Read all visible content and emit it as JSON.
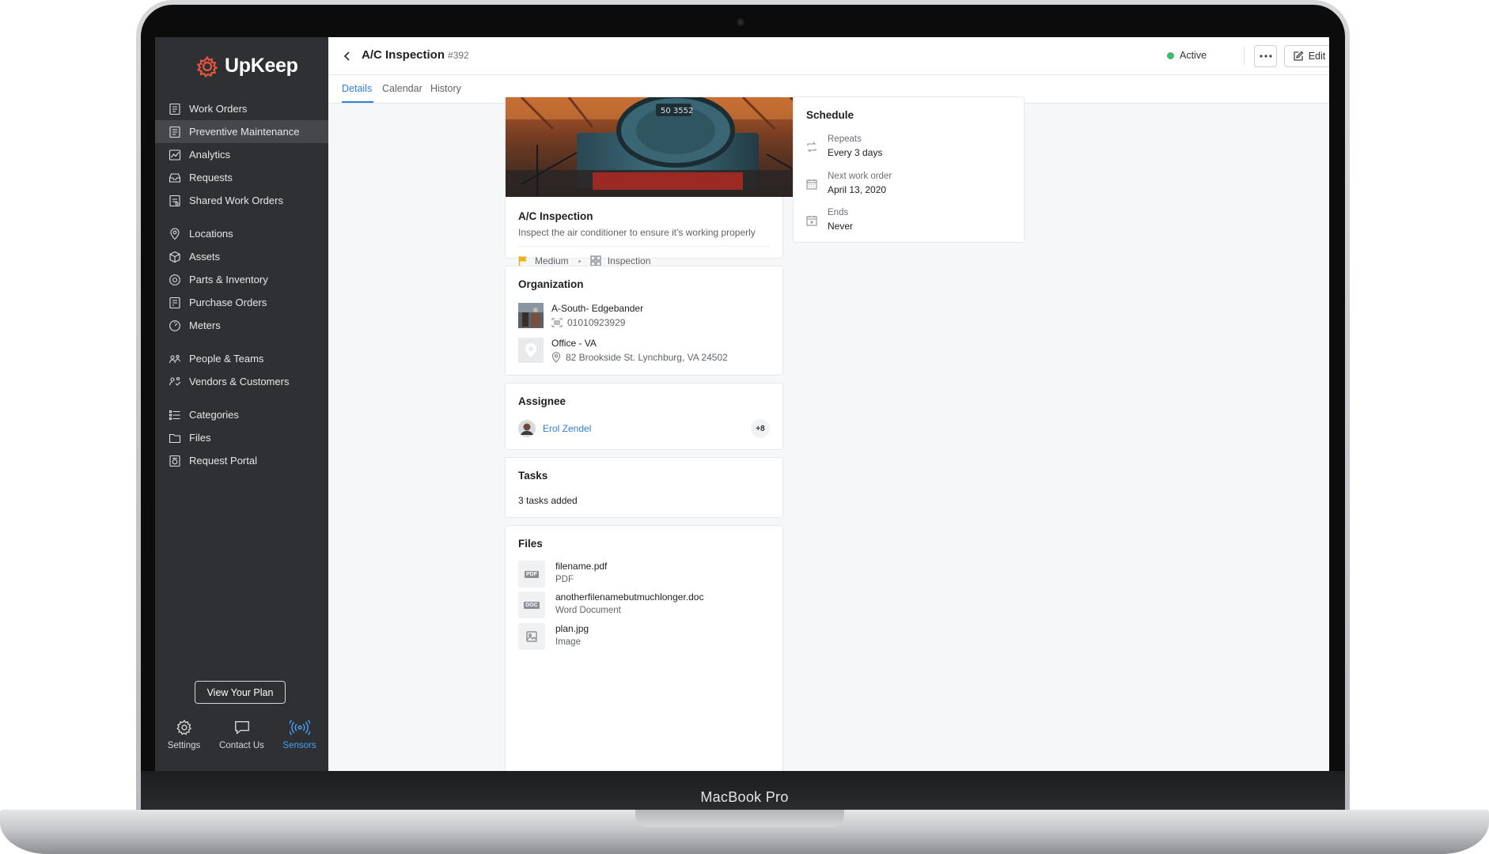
{
  "device": {
    "label": "MacBook Pro"
  },
  "app": {
    "name": "UpKeep",
    "brand_color": "#e8553f",
    "accent_color": "#2f7fd6"
  },
  "sidebar": {
    "groups": [
      [
        {
          "label": "Work Orders",
          "icon": "work-orders-icon"
        },
        {
          "label": "Preventive Maintenance",
          "icon": "preventive-maintenance-icon",
          "active": true
        },
        {
          "label": "Analytics",
          "icon": "analytics-icon"
        },
        {
          "label": "Requests",
          "icon": "requests-icon"
        },
        {
          "label": "Shared Work Orders",
          "icon": "shared-work-orders-icon"
        }
      ],
      [
        {
          "label": "Locations",
          "icon": "location-pin-icon"
        },
        {
          "label": "Assets",
          "icon": "cube-icon"
        },
        {
          "label": "Parts & Inventory",
          "icon": "gear-part-icon"
        },
        {
          "label": "Purchase Orders",
          "icon": "purchase-orders-icon"
        },
        {
          "label": "Meters",
          "icon": "meter-icon"
        }
      ],
      [
        {
          "label": "People & Teams",
          "icon": "people-icon"
        },
        {
          "label": "Vendors & Customers",
          "icon": "vendors-icon"
        }
      ],
      [
        {
          "label": "Categories",
          "icon": "list-icon"
        },
        {
          "label": "Files",
          "icon": "folder-icon"
        },
        {
          "label": "Request Portal",
          "icon": "portal-icon"
        }
      ]
    ],
    "plan_button": "View Your Plan",
    "bottom_tabs": {
      "settings": "Settings",
      "contact": "Contact Us",
      "sensors": "Sensors"
    }
  },
  "header": {
    "title": "A/C Inspection",
    "number": "#392",
    "status": "Active",
    "status_color": "#3dbb6d",
    "edit_label": "Edit"
  },
  "tabs": [
    "Details",
    "Calendar",
    "History"
  ],
  "details": {
    "title": "A/C Inspection",
    "description": "Inspect the air conditioner to ensure it's working properly",
    "priority": "Medium",
    "priority_color": "#e8b31a",
    "category": "Inspection"
  },
  "organization": {
    "title": "Organization",
    "asset_name": "A-South- Edgebander",
    "asset_code": "01010923929",
    "location_name": "Office - VA",
    "location_address": "82 Brookside St. Lynchburg, VA 24502"
  },
  "assignee": {
    "title": "Assignee",
    "name": "Erol Zendel",
    "more": "+8"
  },
  "tasks": {
    "title": "Tasks",
    "summary": "3 tasks added"
  },
  "files": {
    "title": "Files",
    "items": [
      {
        "name": "filename.pdf",
        "type": "PDF",
        "badge": "PDF"
      },
      {
        "name": "anotherfilenamebutmuchlonger.doc",
        "type": "Word Document",
        "badge": "DOC"
      },
      {
        "name": "plan.jpg",
        "type": "Image"
      }
    ]
  },
  "schedule": {
    "title": "Schedule",
    "repeats_label": "Repeats",
    "repeats_value": "Every 3 days",
    "next_label": "Next work order",
    "next_value": "April 13, 2020",
    "ends_label": "Ends",
    "ends_value": "Never"
  }
}
